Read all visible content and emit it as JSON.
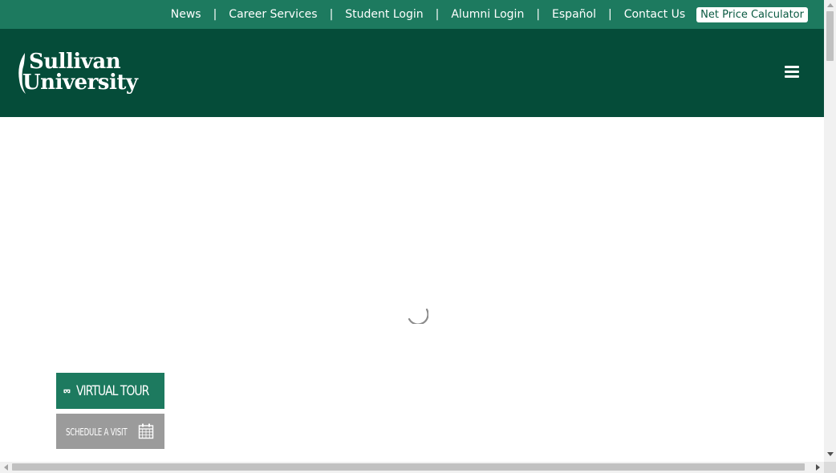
{
  "utility_nav": {
    "items": [
      "News",
      "Career Services",
      "Student Login",
      "Alumni Login",
      "Español",
      "Contact Us"
    ],
    "separator": "|",
    "net_price_calculator": "Net Price Calculator"
  },
  "header": {
    "logo_line1": "Sullivan",
    "logo_line2": "University",
    "menu_icon": "hamburger-menu-icon"
  },
  "main": {
    "loading_indicator": "spinner"
  },
  "cta": {
    "virtual_tour_label": "VIRTUAL TOUR",
    "virtual_tour_icon": "vr-headset-icon",
    "schedule_visit_label": "SCHEDULE A VISIT",
    "schedule_visit_icon": "calendar-icon"
  },
  "colors": {
    "utility_bar": "#1d7a5f",
    "header": "#054c39",
    "virtual_tour": "#1d7a5f",
    "schedule_visit": "#9b9b9b"
  }
}
